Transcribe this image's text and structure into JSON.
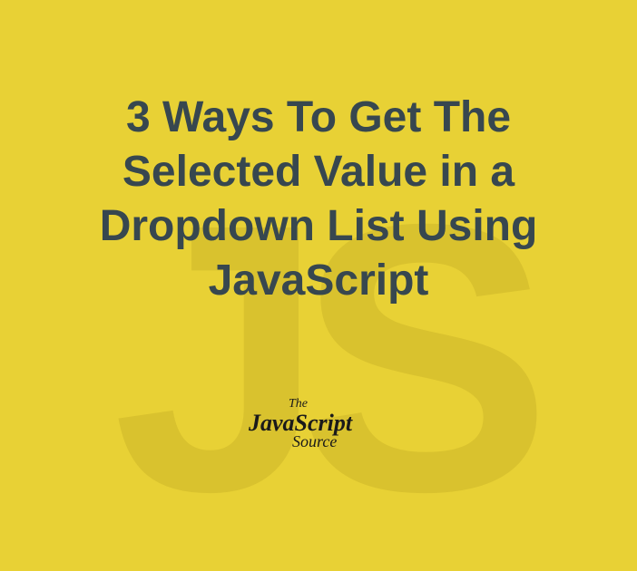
{
  "background_js": "JS",
  "title": "3 Ways To Get The Selected Value in a Dropdown List Using JavaScript",
  "logo": {
    "line1": "The",
    "line2": "JavaScript",
    "line3": "Source"
  },
  "colors": {
    "background": "#e8d135",
    "bg_text": "#d9c22e",
    "title_text": "#37474f",
    "logo_text": "#1a1a1a"
  }
}
